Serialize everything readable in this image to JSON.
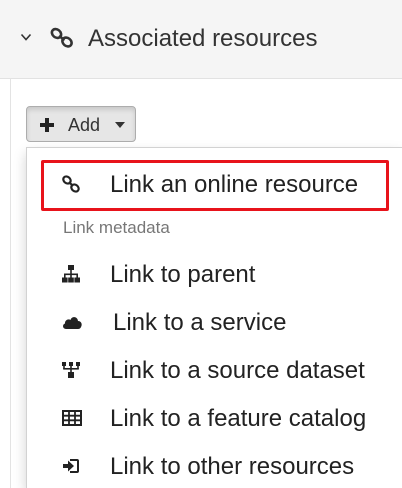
{
  "panel": {
    "title": "Associated resources",
    "collapse_icon": "chevron-down-icon",
    "icon": "link-icon"
  },
  "add_button": {
    "label": "Add",
    "icon": "plus-icon"
  },
  "dropdown": {
    "items": [
      {
        "label": "Link an online resource",
        "icon": "link-icon",
        "highlighted": true
      },
      {
        "label": "Link to parent",
        "icon": "sitemap-icon"
      },
      {
        "label": "Link to a service",
        "icon": "cloud-icon"
      },
      {
        "label": "Link to a source dataset",
        "icon": "source-tree-icon"
      },
      {
        "label": "Link to a feature catalog",
        "icon": "table-icon"
      },
      {
        "label": "Link to other resources",
        "icon": "sign-in-icon"
      }
    ],
    "section_header": "Link metadata"
  },
  "colors": {
    "highlight": "#e8131b",
    "header_bg": "#f5f5f5",
    "button_bg": "#e6e6e6",
    "muted_text": "#777777"
  }
}
